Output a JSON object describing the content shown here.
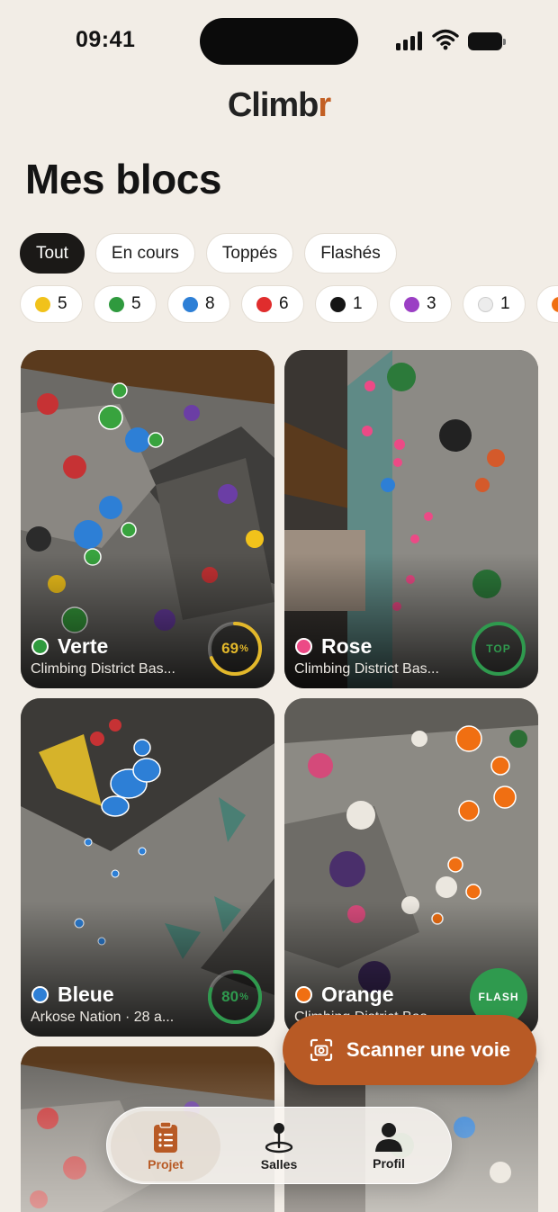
{
  "status": {
    "time": "09:41"
  },
  "app": {
    "logo_main": "Climb",
    "logo_accent": "r"
  },
  "page": {
    "title": "Mes blocs"
  },
  "filters": [
    {
      "label": "Tout",
      "active": true
    },
    {
      "label": "En cours",
      "active": false
    },
    {
      "label": "Toppés",
      "active": false
    },
    {
      "label": "Flashés",
      "active": false
    }
  ],
  "color_filters": [
    {
      "color": "#f1c21b",
      "count": "5"
    },
    {
      "color": "#2f9a3e",
      "count": "5"
    },
    {
      "color": "#2d7fd6",
      "count": "8"
    },
    {
      "color": "#e02d2d",
      "count": "6"
    },
    {
      "color": "#151515",
      "count": "1"
    },
    {
      "color": "#9b3fc4",
      "count": "3"
    },
    {
      "color": "#ececec",
      "count": "1"
    },
    {
      "color": "#f06f12",
      "count": ""
    }
  ],
  "cards": [
    {
      "name": "Verte",
      "place": "Climbing District Bas...",
      "dot": "#2f9a3e",
      "badge_type": "progress",
      "progress": 69,
      "badge_value": "69",
      "badge_unit": "%",
      "badge_color": "#e3b82a"
    },
    {
      "name": "Rose",
      "place": "Climbing District Bas...",
      "dot": "#ec4a86",
      "badge_type": "top",
      "badge_label": "TOP",
      "badge_color": "#2f9a4e"
    },
    {
      "name": "Bleue",
      "place": "Arkose Nation · 28 a...",
      "dot": "#2d7fd6",
      "badge_type": "progress",
      "progress": 80,
      "badge_value": "80",
      "badge_unit": "%",
      "badge_color": "#2f9a4e"
    },
    {
      "name": "Orange",
      "place": "Climbing District Bas...",
      "dot": "#f06f12",
      "badge_type": "flash",
      "badge_label": "FLASH",
      "badge_color": "#2f9a4e"
    }
  ],
  "scan_button": {
    "label": "Scanner une voie"
  },
  "tabbar": [
    {
      "label": "Projet",
      "icon": "clipboard-list-icon",
      "active": true
    },
    {
      "label": "Salles",
      "icon": "map-pin-icon",
      "active": false
    },
    {
      "label": "Profil",
      "icon": "person-icon",
      "active": false
    }
  ],
  "colors": {
    "accent": "#b85a25",
    "background": "#f2ede6"
  }
}
